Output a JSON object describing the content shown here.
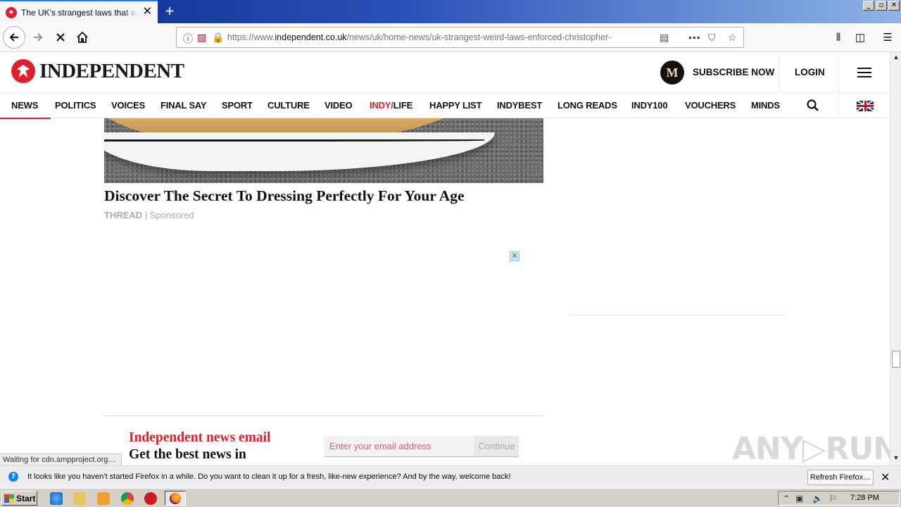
{
  "browser": {
    "tab_title": "The UK's strangest laws that are s",
    "tab_favicon": "independent-eagle-icon",
    "url_host_prefix": "https://www.",
    "url_host": "independent.co.uk",
    "url_path": "/news/uk/home-news/uk-strangest-weird-laws-enforced-christopher-",
    "status_text": "Waiting for cdn.ampproject.org…",
    "notification": {
      "message": "It looks like you haven’t started Firefox in a while. Do you want to clean it up for a fresh, like-new experience? And by the way, welcome back!",
      "button": "Refresh Firefox…"
    }
  },
  "site": {
    "logo_text": "INDEPENDENT",
    "subscribe_badge": "M",
    "subscribe_label": "SUBSCRIBE NOW",
    "login_label": "LOGIN",
    "nav": [
      "NEWS",
      "POLITICS",
      "VOICES",
      "FINAL SAY",
      "SPORT",
      "CULTURE",
      "VIDEO",
      "INDY/",
      "LIFE",
      "HAPPY LIST",
      "INDYBEST",
      "LONG READS",
      "INDY100",
      "VOUCHERS",
      "MINDS"
    ]
  },
  "promo": {
    "title": "Discover The Secret To Dressing Perfectly For Your Age",
    "source": "THREAD",
    "separator": " | ",
    "sponsored": "Sponsored",
    "ad_close": "✕"
  },
  "newsletter": {
    "title": "Independent news email",
    "subtitle": "Get the best news in",
    "placeholder": "Enter your email address",
    "button": "Continue"
  },
  "watermark": "ANY▷RUN",
  "taskbar": {
    "start": "Start",
    "clock": "7:28 PM"
  },
  "colors": {
    "brand_red": "#e01f2d",
    "firefox_blue": "#0a84ff"
  }
}
